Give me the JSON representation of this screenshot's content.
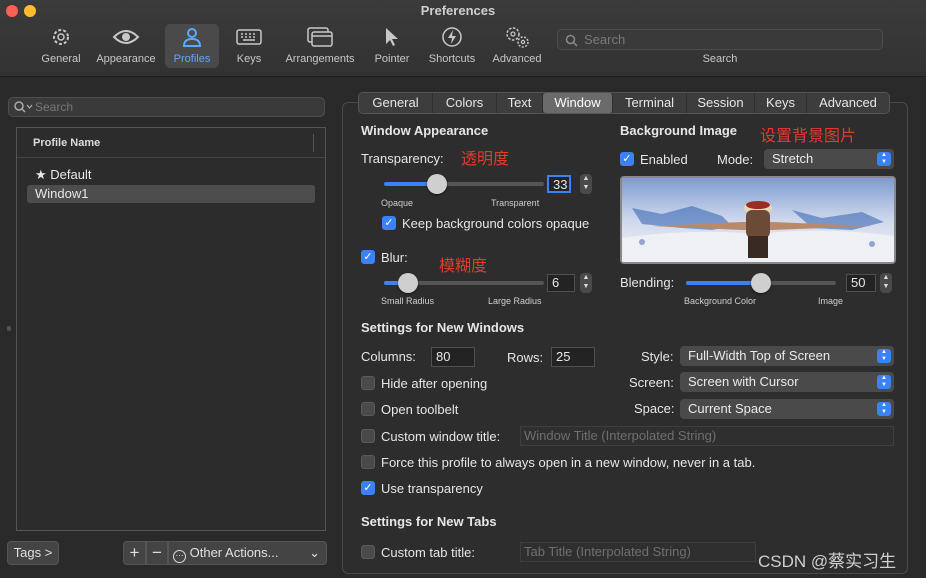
{
  "window": {
    "title": "Preferences"
  },
  "colors": {
    "accent": "#3b82f6",
    "annotation": "#e23b2e",
    "close": "#fe5f57",
    "minimize": "#febc2e"
  },
  "toolbar": {
    "items": [
      {
        "label": "General",
        "icon": "gear-icon"
      },
      {
        "label": "Appearance",
        "icon": "eye-icon"
      },
      {
        "label": "Profiles",
        "icon": "person-icon"
      },
      {
        "label": "Keys",
        "icon": "keyboard-icon"
      },
      {
        "label": "Arrangements",
        "icon": "windows-icon"
      },
      {
        "label": "Pointer",
        "icon": "pointer-icon"
      },
      {
        "label": "Shortcuts",
        "icon": "bolt-icon"
      },
      {
        "label": "Advanced",
        "icon": "gears-icon"
      }
    ],
    "search_placeholder": "Search",
    "search_label": "Search"
  },
  "sidebar": {
    "search_placeholder": "Search",
    "column_header": "Profile Name",
    "profiles": [
      "Default",
      "Window1"
    ],
    "tags_button": "Tags >",
    "add_button": "+",
    "remove_button": "−",
    "other_actions": "Other Actions..."
  },
  "tabs": [
    "General",
    "Colors",
    "Text",
    "Window",
    "Terminal",
    "Session",
    "Keys",
    "Advanced"
  ],
  "window_appearance": {
    "heading": "Window Appearance",
    "transparency_label": "Transparency:",
    "transparency_note": "透明度",
    "transparency_value": "33",
    "transparency_min": "Opaque",
    "transparency_max": "Transparent",
    "keep_bg_opaque": "Keep background colors opaque",
    "blur_label": "Blur:",
    "blur_note": "模糊度",
    "blur_value": "6",
    "blur_min": "Small Radius",
    "blur_max": "Large Radius"
  },
  "background_image": {
    "heading": "Background Image",
    "note": "设置背景图片",
    "enabled_label": "Enabled",
    "mode_label": "Mode:",
    "mode_value": "Stretch",
    "blending_label": "Blending:",
    "blending_value": "50",
    "blending_min": "Background Color",
    "blending_max": "Image"
  },
  "new_windows": {
    "heading": "Settings for New Windows",
    "columns_label": "Columns:",
    "columns_value": "80",
    "rows_label": "Rows:",
    "rows_value": "25",
    "style_label": "Style:",
    "style_value": "Full-Width Top of Screen",
    "screen_label": "Screen:",
    "screen_value": "Screen with Cursor",
    "space_label": "Space:",
    "space_value": "Current Space",
    "hide_after_opening": "Hide after opening",
    "open_toolbelt": "Open toolbelt",
    "custom_window_title": "Custom window title:",
    "window_title_placeholder": "Window Title (Interpolated String)",
    "force_new_window": "Force this profile to always open in a new window, never in a tab.",
    "use_transparency": "Use transparency"
  },
  "new_tabs": {
    "heading": "Settings for New Tabs",
    "custom_tab_title": "Custom tab title:",
    "tab_title_placeholder": "Tab Title (Interpolated String)"
  },
  "watermark": "CSDN @蔡实习生"
}
